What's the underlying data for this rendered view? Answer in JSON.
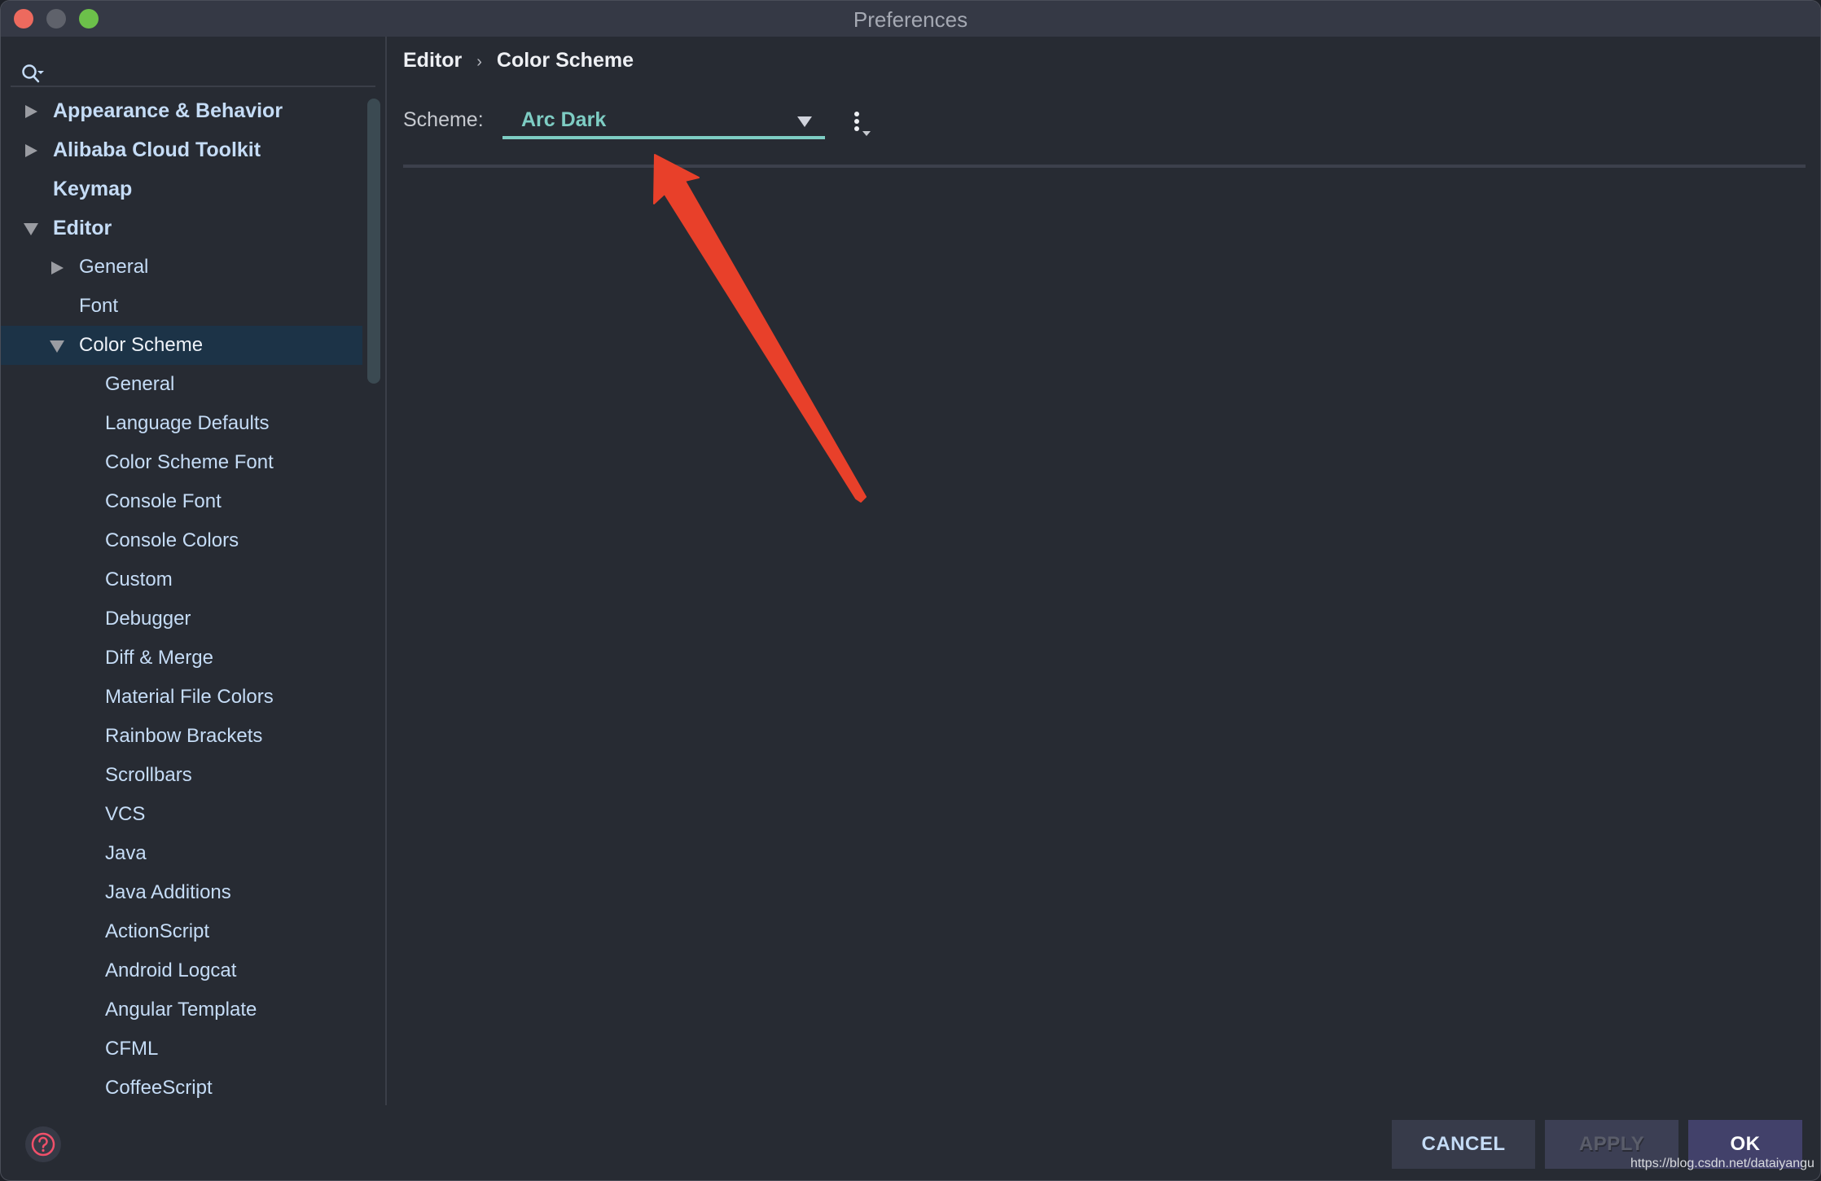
{
  "window": {
    "title": "Preferences",
    "traffic_lights": [
      "close",
      "minimize",
      "maximize"
    ]
  },
  "sidebar": {
    "search": {
      "placeholder": "",
      "icon": "search-icon"
    },
    "items": [
      {
        "label": "Appearance & Behavior",
        "level": 0,
        "bold": true,
        "arrow": "right"
      },
      {
        "label": "Alibaba Cloud Toolkit",
        "level": 0,
        "bold": true,
        "arrow": "right"
      },
      {
        "label": "Keymap",
        "level": 0,
        "bold": true,
        "arrow": "none"
      },
      {
        "label": "Editor",
        "level": 0,
        "bold": true,
        "arrow": "down"
      },
      {
        "label": "General",
        "level": 1,
        "bold": false,
        "arrow": "right"
      },
      {
        "label": "Font",
        "level": 1,
        "bold": false,
        "arrow": "none"
      },
      {
        "label": "Color Scheme",
        "level": 1,
        "bold": false,
        "arrow": "down",
        "selected": true
      },
      {
        "label": "General",
        "level": 2
      },
      {
        "label": "Language Defaults",
        "level": 2
      },
      {
        "label": "Color Scheme Font",
        "level": 2
      },
      {
        "label": "Console Font",
        "level": 2
      },
      {
        "label": "Console Colors",
        "level": 2
      },
      {
        "label": "Custom",
        "level": 2
      },
      {
        "label": "Debugger",
        "level": 2
      },
      {
        "label": "Diff & Merge",
        "level": 2
      },
      {
        "label": "Material File Colors",
        "level": 2
      },
      {
        "label": "Rainbow Brackets",
        "level": 2
      },
      {
        "label": "Scrollbars",
        "level": 2
      },
      {
        "label": "VCS",
        "level": 2
      },
      {
        "label": "Java",
        "level": 2
      },
      {
        "label": "Java Additions",
        "level": 2
      },
      {
        "label": "ActionScript",
        "level": 2
      },
      {
        "label": "Android Logcat",
        "level": 2
      },
      {
        "label": "Angular Template",
        "level": 2
      },
      {
        "label": "CFML",
        "level": 2
      },
      {
        "label": "CoffeeScript",
        "level": 2
      }
    ]
  },
  "content": {
    "breadcrumb": [
      "Editor",
      "Color Scheme"
    ],
    "breadcrumb_separator": "›",
    "scheme_label": "Scheme:",
    "scheme_value": "Arc Dark",
    "accent_color": "#7ecdc4"
  },
  "footer": {
    "help_icon": "help-icon",
    "cancel_label": "CANCEL",
    "apply_label": "APPLY",
    "ok_label": "OK"
  },
  "annotation": {
    "type": "arrow",
    "color": "#e8402a",
    "points_to": "scheme-dropdown"
  },
  "watermark": "https://blog.csdn.net/dataiyangu"
}
